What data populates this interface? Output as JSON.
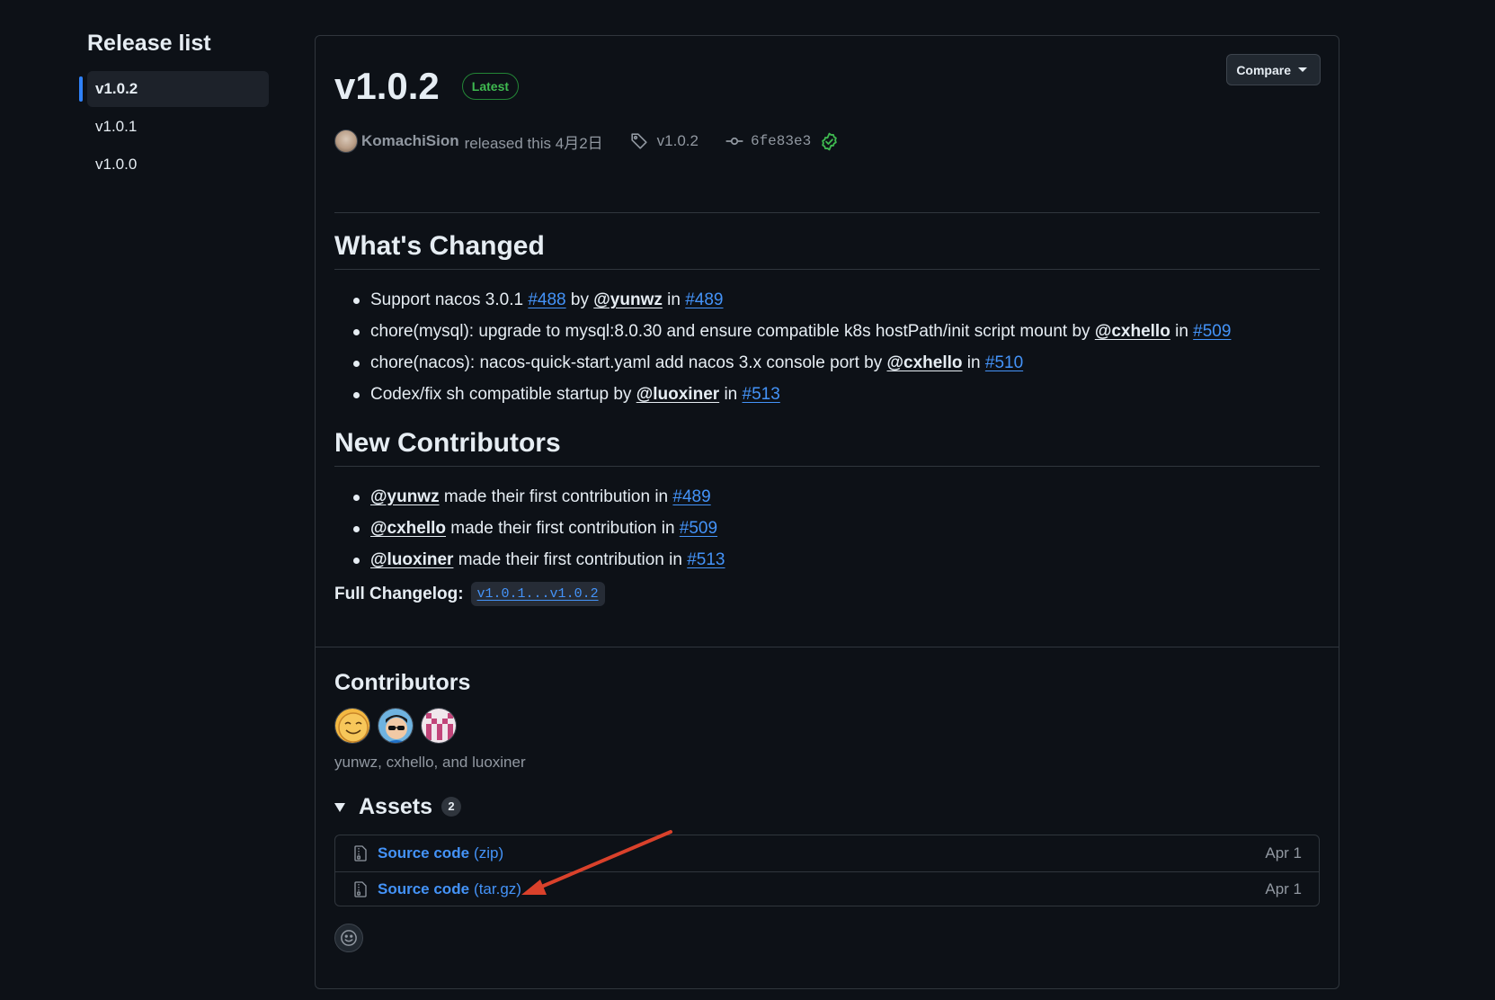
{
  "sidebar": {
    "title": "Release list",
    "items": [
      {
        "label": "v1.0.2",
        "active": true
      },
      {
        "label": "v1.0.1",
        "active": false
      },
      {
        "label": "v1.0.0",
        "active": false
      }
    ]
  },
  "release": {
    "title": "v1.0.2",
    "badge": "Latest",
    "compare_label": "Compare",
    "author": "KomachiSion",
    "released_text": "released this 4月2日",
    "tag": "v1.0.2",
    "commit": "6fe83e3"
  },
  "whats_changed": {
    "heading": "What's Changed",
    "items": [
      {
        "text": "Support nacos 3.0.1",
        "issue": "#488",
        "by": "by",
        "user": "@yunwz",
        "in": "in",
        "pr": "#489"
      },
      {
        "text": "chore(mysql): upgrade to mysql:8.0.30 and ensure compatible k8s hostPath/init script mount",
        "by": "by",
        "user": "@cxhello",
        "in": "in",
        "pr": "#509"
      },
      {
        "text": "chore(nacos): nacos-quick-start.yaml add nacos 3.x console port",
        "by": "by",
        "user": "@cxhello",
        "in": "in",
        "pr": "#510"
      },
      {
        "text": "Codex/fix sh compatible startup",
        "by": "by",
        "user": "@luoxiner",
        "in": "in",
        "pr": "#513"
      }
    ]
  },
  "new_contributors": {
    "heading": "New Contributors",
    "items": [
      {
        "user": "@yunwz",
        "text": "made their first contribution in",
        "pr": "#489"
      },
      {
        "user": "@cxhello",
        "text": "made their first contribution in",
        "pr": "#509"
      },
      {
        "user": "@luoxiner",
        "text": "made their first contribution in",
        "pr": "#513"
      }
    ]
  },
  "changelog": {
    "label": "Full Changelog:",
    "link": "v1.0.1...v1.0.2"
  },
  "contributors": {
    "heading": "Contributors",
    "names": "yunwz, cxhello, and luoxiner"
  },
  "assets": {
    "heading": "Assets",
    "count": "2",
    "items": [
      {
        "name": "Source code",
        "ext": "(zip)",
        "date": "Apr 1"
      },
      {
        "name": "Source code",
        "ext": "(tar.gz)",
        "date": "Apr 1"
      }
    ]
  },
  "colors": {
    "background": "#0d1117",
    "border": "#30363d",
    "link": "#4493f8",
    "accent": "#2f81f7",
    "success": "#3fb950",
    "annotation": "#d9412b"
  }
}
